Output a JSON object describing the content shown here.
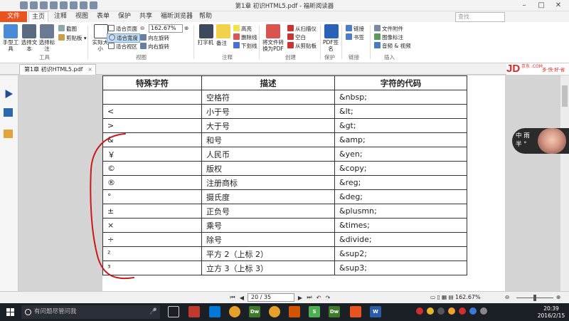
{
  "window": {
    "title": "第1章 初识HTML5.pdf - 福昕阅读器",
    "search_placeholder": "查找"
  },
  "menu": {
    "file": "文件",
    "tabs": [
      "主页",
      "注释",
      "视图",
      "表单",
      "保护",
      "共享",
      "福昕浏览器",
      "帮助"
    ]
  },
  "ribbon": {
    "tools": {
      "hand": "手型工具",
      "select_text": "选择文本",
      "select_annot": "选择标注",
      "snapshot": "截图",
      "clipboard": "剪贴板",
      "group": "工具"
    },
    "view": {
      "actual_size": "实际大小",
      "fit_page": "适合页面",
      "fit_width": "适合宽度",
      "fit_visible": "适合视区",
      "zoom_value": "162.67%",
      "rotate_left": "向左旋转",
      "rotate_right": "向右旋转",
      "group": "视图"
    },
    "comment": {
      "typewriter": "打字机",
      "note": "备注",
      "highlight": "高亮",
      "strikeout": "删除线",
      "underline": "下划线",
      "group": "注释"
    },
    "create": {
      "convert": "将文件转换为PDF",
      "from_scanner": "从扫描仪",
      "blank": "空白",
      "from_clipboard": "从剪贴板",
      "group": "创建"
    },
    "protect": {
      "pdf_sign": "PDF签名",
      "group": "保护"
    },
    "link": {
      "link": "链接",
      "bookmark": "书签",
      "group": "链接"
    },
    "insert": {
      "file_attach": "文件附件",
      "image_annot": "图像标注",
      "audio_video": "音频 & 视频",
      "group": "插入"
    }
  },
  "doc_tab": {
    "label": "第1章 初识HTML5.pdf"
  },
  "ad": {
    "logo": "JD",
    "com": "京东 .COM",
    "slogan": "多·快·好·省"
  },
  "table": {
    "headers": [
      "特殊字符",
      "描述",
      "字符的代码"
    ],
    "rows": [
      [
        "",
        "空格符",
        "&nbsp;"
      ],
      [
        "<",
        "小于号",
        "&lt;"
      ],
      [
        ">",
        "大于号",
        "&gt;"
      ],
      [
        "&",
        "和号",
        "&amp;"
      ],
      [
        "￥",
        "人民币",
        "&yen;"
      ],
      [
        "©",
        "版权",
        "&copy;"
      ],
      [
        "®",
        "注册商标",
        "&reg;"
      ],
      [
        "°",
        "摄氏度",
        "&deg;"
      ],
      [
        "±",
        "正负号",
        "&plusmn;"
      ],
      [
        "×",
        "乘号",
        "&times;"
      ],
      [
        "÷",
        "除号",
        "&divide;"
      ],
      [
        "²",
        "平方 2（上标 2）",
        "&sup2;"
      ],
      [
        "³",
        "立方 3（上标 3）",
        "&sup3;"
      ]
    ]
  },
  "cam": {
    "text": "中 雨 半 °"
  },
  "status": {
    "page": "20 / 35",
    "zoom": "162.67%"
  },
  "taskbar": {
    "search": "有问题尽管问我",
    "time": "20:39",
    "date": "2016/2/15"
  },
  "colors": {
    "file_tab": "#e8531f",
    "annotation": "#cc1a1a",
    "jd_red": "#e1251b"
  }
}
